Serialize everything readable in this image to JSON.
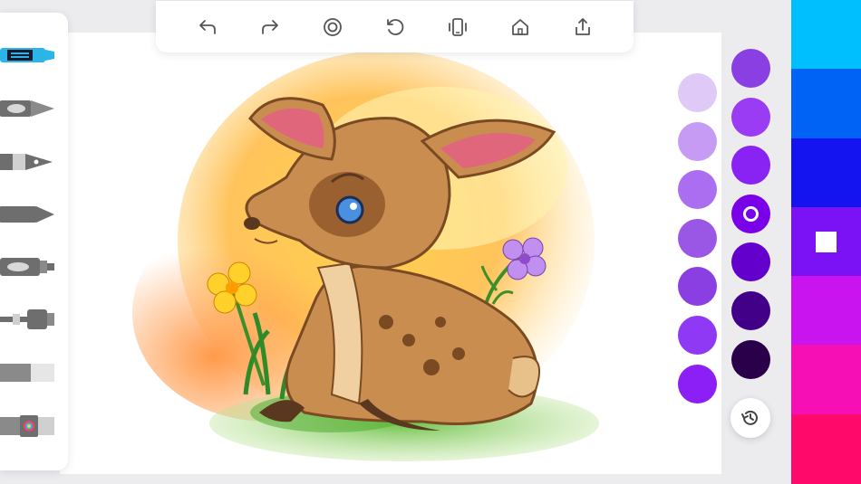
{
  "toolbar": {
    "buttons": [
      {
        "name": "undo-button",
        "icon": "undo-icon"
      },
      {
        "name": "redo-button",
        "icon": "redo-icon"
      },
      {
        "name": "focus-button",
        "icon": "target-icon"
      },
      {
        "name": "reset-button",
        "icon": "rotate-ccw-icon"
      },
      {
        "name": "device-button",
        "icon": "phone-vibrate-icon"
      },
      {
        "name": "home-button",
        "icon": "home-icon"
      },
      {
        "name": "share-button",
        "icon": "share-icon"
      }
    ]
  },
  "tools": [
    {
      "name": "marker",
      "icon": "marker-icon",
      "color": "#2ab4e8",
      "active": true
    },
    {
      "name": "brush-pen",
      "icon": "brush-pen-icon",
      "color": "#6e6e6e",
      "active": false
    },
    {
      "name": "fountain-pen",
      "icon": "fountain-pen-icon",
      "color": "#6e6e6e",
      "active": false
    },
    {
      "name": "crayon",
      "icon": "crayon-icon",
      "color": "#6e6e6e",
      "active": false
    },
    {
      "name": "highlighter",
      "icon": "highlighter-icon",
      "color": "#6e6e6e",
      "active": false
    },
    {
      "name": "airbrush",
      "icon": "airbrush-icon",
      "color": "#6e6e6e",
      "active": false
    },
    {
      "name": "eraser",
      "icon": "eraser-icon",
      "color": "#6e6e6e",
      "active": false
    },
    {
      "name": "color-picker",
      "icon": "color-wheel-icon",
      "color": "#6e6e6e",
      "active": false
    }
  ],
  "swatches_left": [
    "#dec9f7",
    "#c59bf3",
    "#ab6ef0",
    "#9a57e6",
    "#8a3fe2",
    "#9039f5",
    "#8c1ff5"
  ],
  "swatches_right": [
    "#8a3fe2",
    "#9a3cf3",
    "#8823f4",
    "#7a00ea",
    "#6400cc",
    "#420089",
    "#290049"
  ],
  "selected_swatch": 3,
  "palette": [
    "#00bfff",
    "#0063f5",
    "#1414f0",
    "#7a12f5",
    "#c914f0",
    "#f50fb5",
    "#ff0a6b"
  ],
  "selected_palette": 3,
  "history": {
    "icon": "history-icon"
  },
  "artwork": {
    "subject": "fawn-coloring-page"
  }
}
